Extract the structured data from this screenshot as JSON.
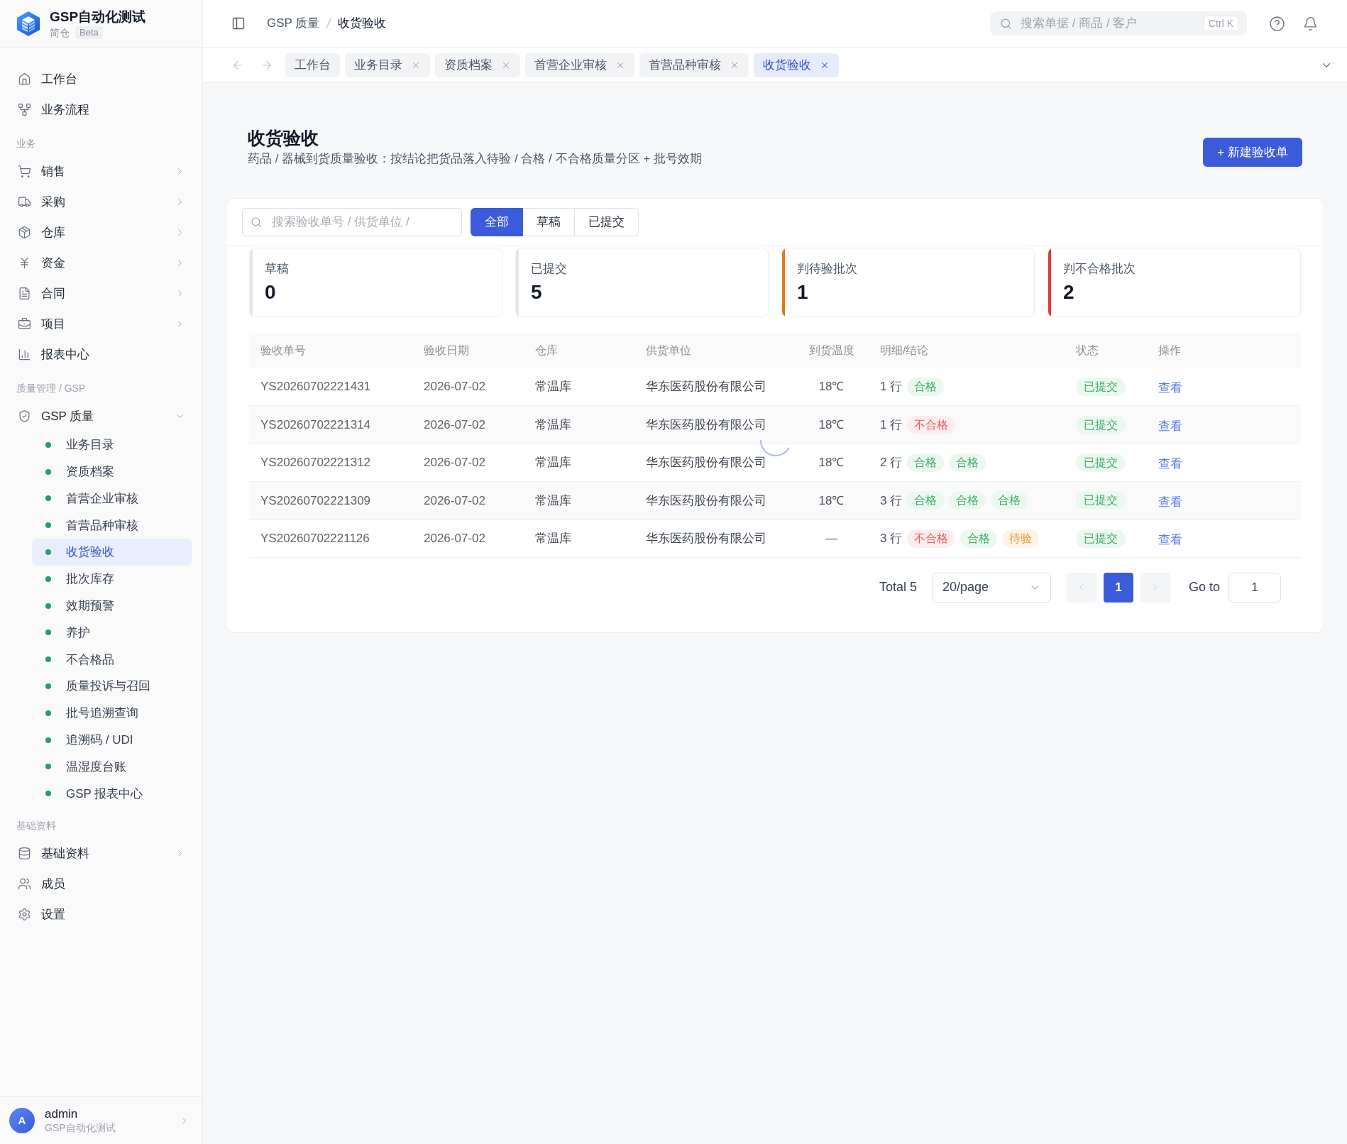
{
  "app": {
    "name": "GSP自动化测试",
    "subtitle": "简仓",
    "badge": "Beta"
  },
  "sidebar": {
    "sections": [
      {
        "items": [
          {
            "label": "工作台",
            "kind": "link",
            "selected": false
          },
          {
            "label": "业务流程",
            "kind": "link",
            "selected": false
          }
        ]
      },
      {
        "title": "业务",
        "items": [
          {
            "label": "销售",
            "kind": "group",
            "expanded": false,
            "selected": false
          },
          {
            "label": "采购",
            "kind": "group",
            "expanded": false,
            "selected": false
          },
          {
            "label": "仓库",
            "kind": "group",
            "expanded": false,
            "selected": false
          },
          {
            "label": "资金",
            "kind": "group",
            "expanded": false,
            "selected": false
          },
          {
            "label": "合同",
            "kind": "group",
            "expanded": false,
            "selected": false
          },
          {
            "label": "项目",
            "kind": "group",
            "expanded": false,
            "selected": false
          },
          {
            "label": "报表中心",
            "kind": "link",
            "selected": false
          }
        ]
      },
      {
        "title": "质量管理 / GSP",
        "items": [
          {
            "label": "GSP 质量",
            "kind": "group",
            "expanded": true,
            "selected": false,
            "children": [
              {
                "label": "业务目录",
                "selected": false
              },
              {
                "label": "资质档案",
                "selected": false
              },
              {
                "label": "首营企业审核",
                "selected": false
              },
              {
                "label": "首营品种审核",
                "selected": false
              },
              {
                "label": "收货验收",
                "selected": true
              },
              {
                "label": "批次库存",
                "selected": false
              },
              {
                "label": "效期预警",
                "selected": false
              },
              {
                "label": "养护",
                "selected": false
              },
              {
                "label": "不合格品",
                "selected": false
              },
              {
                "label": "质量投诉与召回",
                "selected": false
              },
              {
                "label": "批号追溯查询",
                "selected": false
              },
              {
                "label": "追溯码 / UDI",
                "selected": false
              },
              {
                "label": "温湿度台账",
                "selected": false
              },
              {
                "label": "GSP 报表中心",
                "selected": false
              }
            ]
          }
        ]
      },
      {
        "title": "基础资料",
        "items": [
          {
            "label": "基础资料",
            "kind": "group",
            "expanded": false,
            "selected": false
          },
          {
            "label": "成员",
            "kind": "link",
            "selected": false
          },
          {
            "label": "设置",
            "kind": "link",
            "selected": false
          }
        ]
      }
    ]
  },
  "user": {
    "avatar": "A",
    "name": "admin",
    "org": "GSP自动化测试"
  },
  "topbar": {
    "breadcrumb": [
      "GSP 质量",
      "收货验收"
    ],
    "search": {
      "placeholder": "搜索单据 / 商品 / 客户",
      "shortcut": "Ctrl K"
    }
  },
  "tabs": [
    {
      "label": "工作台",
      "closable": false,
      "selected": false
    },
    {
      "label": "业务目录",
      "closable": true,
      "selected": false
    },
    {
      "label": "资质档案",
      "closable": true,
      "selected": false
    },
    {
      "label": "首营企业审核",
      "closable": true,
      "selected": false
    },
    {
      "label": "首营品种审核",
      "closable": true,
      "selected": false
    },
    {
      "label": "收货验收",
      "closable": true,
      "selected": true
    }
  ],
  "page": {
    "title": "收货验收",
    "description": "药品 / 器械到货质量验收：按结论把货品落入待验 / 合格 / 不合格质量分区 + 批号效期",
    "new_button": "+ 新建验收单"
  },
  "filter": {
    "search": {
      "placeholder": "搜索验收单号 / 供货单位 /"
    },
    "segments": [
      {
        "label": "全部",
        "selected": true
      },
      {
        "label": "草稿",
        "selected": false
      },
      {
        "label": "已提交",
        "selected": false
      }
    ]
  },
  "stats": [
    {
      "label": "草稿",
      "value": "0",
      "color": "#e3e5e8"
    },
    {
      "label": "已提交",
      "value": "5",
      "color": "#e3e5e8"
    },
    {
      "label": "判待验批次",
      "value": "1",
      "color": "#e07b12"
    },
    {
      "label": "判不合格批次",
      "value": "2",
      "color": "#e53935"
    }
  ],
  "table": {
    "columns": [
      "验收单号",
      "验收日期",
      "仓库",
      "供货单位",
      "到货温度",
      "明细/结论",
      "状态",
      "操作"
    ],
    "rows": [
      {
        "id": "YS20260702221431",
        "date": "2026-07-02",
        "warehouse": "常温库",
        "supplier": "华东医药股份有限公司",
        "temperature": "18℃",
        "lines": "1 行",
        "verdicts": [
          {
            "label": "合格",
            "kind": "pass"
          }
        ],
        "status": {
          "label": "已提交",
          "kind": "submitted"
        },
        "action": "查看"
      },
      {
        "id": "YS20260702221314",
        "date": "2026-07-02",
        "warehouse": "常温库",
        "supplier": "华东医药股份有限公司",
        "temperature": "18℃",
        "lines": "1 行",
        "verdicts": [
          {
            "label": "不合格",
            "kind": "fail"
          }
        ],
        "status": {
          "label": "已提交",
          "kind": "submitted"
        },
        "action": "查看"
      },
      {
        "id": "YS20260702221312",
        "date": "2026-07-02",
        "warehouse": "常温库",
        "supplier": "华东医药股份有限公司",
        "temperature": "18℃",
        "lines": "2 行",
        "verdicts": [
          {
            "label": "合格",
            "kind": "pass"
          },
          {
            "label": "合格",
            "kind": "pass"
          }
        ],
        "status": {
          "label": "已提交",
          "kind": "submitted"
        },
        "action": "查看"
      },
      {
        "id": "YS20260702221309",
        "date": "2026-07-02",
        "warehouse": "常温库",
        "supplier": "华东医药股份有限公司",
        "temperature": "18℃",
        "lines": "3 行",
        "verdicts": [
          {
            "label": "合格",
            "kind": "pass"
          },
          {
            "label": "合格",
            "kind": "pass"
          },
          {
            "label": "合格",
            "kind": "pass"
          }
        ],
        "status": {
          "label": "已提交",
          "kind": "submitted"
        },
        "action": "查看"
      },
      {
        "id": "YS20260702221126",
        "date": "2026-07-02",
        "warehouse": "常温库",
        "supplier": "华东医药股份有限公司",
        "temperature": "—",
        "lines": "3 行",
        "verdicts": [
          {
            "label": "不合格",
            "kind": "fail"
          },
          {
            "label": "合格",
            "kind": "pass"
          },
          {
            "label": "待验",
            "kind": "pending"
          }
        ],
        "status": {
          "label": "已提交",
          "kind": "submitted"
        },
        "action": "查看"
      }
    ]
  },
  "pagination": {
    "total": "Total 5",
    "page_size": "20/page",
    "prev": {
      "disabled": true
    },
    "pages": [
      {
        "label": "1",
        "selected": true
      }
    ],
    "next": {
      "disabled": true
    },
    "goto_label": "Go to",
    "goto_value": "1"
  }
}
